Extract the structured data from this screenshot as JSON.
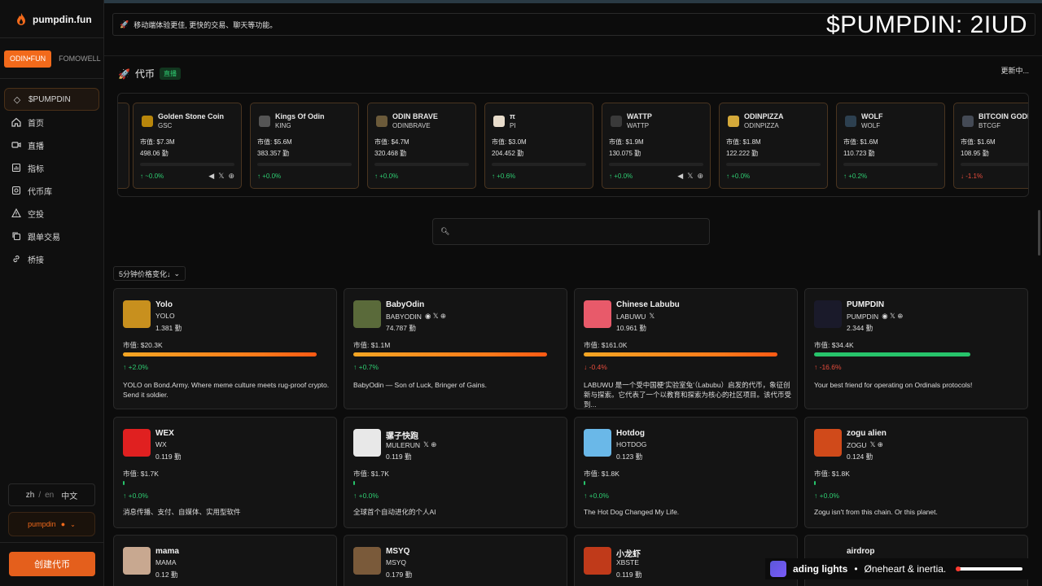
{
  "brand": {
    "name": "pumpdin.fun"
  },
  "overlay": {
    "ticker_text": "$PUMPDIN: 2IUD"
  },
  "platform_tabs": [
    {
      "label": "ODIN•FUN",
      "active": true
    },
    {
      "label": "FOMOWELL",
      "active": false
    }
  ],
  "nav": [
    {
      "label": "$PUMPDIN",
      "icon": "diamond-icon",
      "active": true
    },
    {
      "label": "首页",
      "icon": "home-icon"
    },
    {
      "label": "直播",
      "icon": "video-icon"
    },
    {
      "label": "指标",
      "icon": "chart-icon"
    },
    {
      "label": "代币库",
      "icon": "database-icon"
    },
    {
      "label": "空投",
      "icon": "warning-icon"
    },
    {
      "label": "跟单交易",
      "icon": "copy-icon"
    },
    {
      "label": "桥接",
      "icon": "link-icon"
    }
  ],
  "language": {
    "zh": "zh",
    "sep": "/",
    "en": "en",
    "current": "中文"
  },
  "user": {
    "name": "pumpdin"
  },
  "create_button": {
    "label": "创建代币"
  },
  "banner": {
    "text": "移动端体验更佳, 更快的交易、聊天等功能。"
  },
  "section": {
    "title": "代币",
    "live_badge": "直播",
    "updating": "更新中..."
  },
  "carousel": [
    {
      "name": "Golden Stone Coin",
      "symbol": "GSC",
      "mcap": "市值: $7.3M",
      "holders": "498.06 勤",
      "change": "↑ ~0.0%",
      "bar": 1.0,
      "negative": false,
      "social": true,
      "icon_color": "#b8860b"
    },
    {
      "name": "Kings Of Odin",
      "symbol": "KING",
      "mcap": "市值: $5.6M",
      "holders": "383.357 勤",
      "change": "↑ +0.0%",
      "bar": 1.0,
      "negative": false,
      "social": false,
      "icon_color": "#555555"
    },
    {
      "name": "ODIN BRAVE",
      "symbol": "ODINBRAVE",
      "mcap": "市值: $4.7M",
      "holders": "320.468 勤",
      "change": "↑ +0.0%",
      "bar": 1.0,
      "negative": false,
      "social": false,
      "icon_color": "#6b5a3a"
    },
    {
      "name": "π",
      "symbol": "PI",
      "mcap": "市值: $3.0M",
      "holders": "204.452 勤",
      "change": "↑ +0.6%",
      "bar": 1.0,
      "negative": false,
      "social": false,
      "icon_color": "#e8dccb"
    },
    {
      "name": "WATTP",
      "symbol": "WATTP",
      "mcap": "市值: $1.9M",
      "holders": "130.075 勤",
      "change": "↑ +0.0%",
      "bar": 1.0,
      "negative": false,
      "social": true,
      "icon_color": "#3a3a3a"
    },
    {
      "name": "ODINPIZZA",
      "symbol": "ODINPIZZA",
      "mcap": "市值: $1.8M",
      "holders": "122.222 勤",
      "change": "↑ +0.0%",
      "bar": 1.0,
      "negative": false,
      "social": false,
      "icon_color": "#d4a93a"
    },
    {
      "name": "WOLF",
      "symbol": "WOLF",
      "mcap": "市值: $1.6M",
      "holders": "110.723 勤",
      "change": "↑ +0.2%",
      "bar": 1.0,
      "negative": false,
      "social": false,
      "icon_color": "#2d4050"
    },
    {
      "name": "BITCOIN GODFA",
      "symbol": "BTCGF",
      "mcap": "市值: $1.6M",
      "holders": "108.95 勤",
      "change": "↓ -1.1%",
      "bar": 1.0,
      "negative": true,
      "social": false,
      "icon_color": "#444a55"
    }
  ],
  "search": {
    "placeholder": ""
  },
  "sort": {
    "label": "5分钟价格变化↓"
  },
  "tokens": [
    {
      "name": "Yolo",
      "symbol": "YOLO",
      "holders": "1.381 勤",
      "mcap": "市值: $20.3K",
      "bar": 0.94,
      "bar_style": "grad",
      "change": "↑ +2.0%",
      "negative": false,
      "desc": "YOLO on Bond.Army. Where meme culture meets rug-proof crypto. Send it soldier.",
      "social": "",
      "icon_color": "#c8901e"
    },
    {
      "name": "BabyOdin",
      "symbol": "BABYODIN",
      "holders": "74.787 勤",
      "mcap": "市值: $1.1M",
      "bar": 0.94,
      "bar_style": "grad",
      "change": "↑ +0.7%",
      "negative": false,
      "desc": "BabyOdin — Son of Luck, Bringer of Gains.",
      "social": "◉ 𝕏 ⊕",
      "icon_color": "#5a6a3a"
    },
    {
      "name": "Chinese Labubu",
      "symbol": "LABUWU",
      "holders": "10.961 勤",
      "mcap": "市值: $161.0K",
      "bar": 0.94,
      "bar_style": "grad",
      "change": "↓ -0.4%",
      "negative": true,
      "desc": "LABUWU 是一个受中国梗‘实验室兔’（Labubu）启发的代币，象征创新与探索。它代表了一个以教育和探索为核心的社区项目。该代币受到...",
      "social": "𝕏",
      "icon_color": "#e85a6a"
    },
    {
      "name": "PUMPDIN",
      "symbol": "PUMPDIN",
      "holders": "2.344 勤",
      "mcap": "市值: $34.4K",
      "bar": 0.76,
      "bar_style": "green",
      "change": "↑ -16.6%",
      "negative": true,
      "desc": "Your best friend for operating on Ordinals protocols!",
      "social": "◉ 𝕏 ⊕",
      "icon_color": "#1a1a2a"
    },
    {
      "name": "WEX",
      "symbol": "WX",
      "holders": "0.119 勤",
      "mcap": "市值: $1.7K",
      "bar": 0.0,
      "bar_style": "tiny",
      "change": "↑ +0.0%",
      "negative": false,
      "desc": "消息传播、支付、自媒体、实用型软件",
      "social": "",
      "icon_color": "#e02020"
    },
    {
      "name": "骡子快跑",
      "symbol": "MULERUN",
      "holders": "0.119 勤",
      "mcap": "市值: $1.7K",
      "bar": 0.0,
      "bar_style": "tiny",
      "change": "↑ +0.0%",
      "negative": false,
      "desc": "全球首个自动进化的个人AI",
      "social": "𝕏 ⊕",
      "icon_color": "#e8e8e8"
    },
    {
      "name": "Hotdog",
      "symbol": "HOTDOG",
      "holders": "0.123 勤",
      "mcap": "市值: $1.8K",
      "bar": 0.0,
      "bar_style": "tiny",
      "change": "↑ +0.0%",
      "negative": false,
      "desc": "The Hot Dog Changed My Life.",
      "social": "",
      "icon_color": "#6ab8e8"
    },
    {
      "name": "zogu alien",
      "symbol": "ZOGU",
      "holders": "0.124 勤",
      "mcap": "市值: $1.8K",
      "bar": 0.01,
      "bar_style": "tiny",
      "change": "↑ +0.0%",
      "negative": false,
      "desc": "Zogu isn't from this chain. Or this planet.",
      "social": "𝕏 ⊕",
      "icon_color": "#d04a1a"
    },
    {
      "name": "mama",
      "symbol": "MAMA",
      "holders": "0.12 勤",
      "mcap": "",
      "bar": 0,
      "bar_style": "none",
      "change": "",
      "negative": false,
      "desc": "",
      "social": "",
      "icon_color": "#c8a890"
    },
    {
      "name": "MSYQ",
      "symbol": "MSYQ",
      "holders": "0.179 勤",
      "mcap": "",
      "bar": 0,
      "bar_style": "none",
      "change": "",
      "negative": false,
      "desc": "",
      "social": "",
      "icon_color": "#7a5a3a"
    },
    {
      "name": "小龙虾",
      "symbol": "XBSTE",
      "holders": "0.119 勤",
      "mcap": "",
      "bar": 0,
      "bar_style": "none",
      "change": "",
      "negative": false,
      "desc": "",
      "social": "",
      "icon_color": "#c03a1a"
    },
    {
      "name": "airdrop",
      "symbol": "",
      "holders": "",
      "mcap": "",
      "bar": 0,
      "bar_style": "none",
      "change": "",
      "negative": false,
      "desc": "",
      "social": "",
      "icon_color": "#141414"
    }
  ],
  "now_playing": {
    "text": "ading lights",
    "bullet": "•",
    "artist": "Øneheart & inertia."
  }
}
